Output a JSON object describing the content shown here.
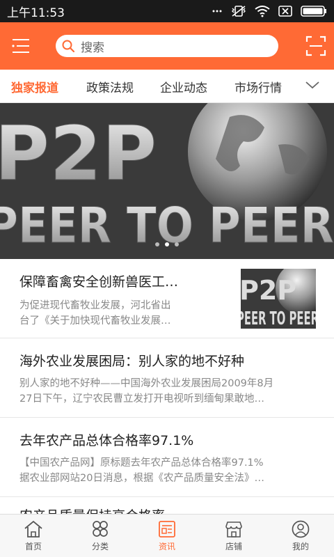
{
  "status": {
    "time": "上午11:53"
  },
  "search": {
    "placeholder": "搜索"
  },
  "tabs": [
    {
      "label": "独家报道",
      "active": true
    },
    {
      "label": "政策法规",
      "active": false
    },
    {
      "label": "企业动态",
      "active": false
    },
    {
      "label": "市场行情",
      "active": false
    }
  ],
  "banner": {
    "big_text": "P2P",
    "sub_text": "PEER TO PEER",
    "dots": 3,
    "active_dot": 1
  },
  "news": [
    {
      "title": "保障畜禽安全创新兽医工…",
      "desc": "为促进现代畜牧业发展，河北省出\n台了《关于加快现代畜牧业发展…",
      "has_thumb": true
    },
    {
      "title": "海外农业发展困局：别人家的地不好种",
      "desc": "别人家的地不好种——中国海外农业发展困局2009年8月\n27日下午，辽宁农民曹立发打开电视听到缅甸果敢地…",
      "has_thumb": false
    },
    {
      "title": "去年农产品总体合格率97.1%",
      "desc": "【中国农产品网】原标题去年农产品总体合格率97.1%\n据农业部网站20日消息，根据《农产品质量安全法》…",
      "has_thumb": false
    },
    {
      "title": "农产品质量保持高合格率",
      "desc": "",
      "has_thumb": false
    }
  ],
  "bottom_nav": [
    {
      "label": "首页",
      "icon": "home-icon",
      "active": false
    },
    {
      "label": "分类",
      "icon": "category-icon",
      "active": false
    },
    {
      "label": "资讯",
      "icon": "news-icon",
      "active": true
    },
    {
      "label": "店铺",
      "icon": "store-icon",
      "active": false
    },
    {
      "label": "我的",
      "icon": "profile-icon",
      "active": false
    }
  ],
  "colors": {
    "accent": "#ff6a35",
    "statusbar": "#1a1a1a"
  }
}
